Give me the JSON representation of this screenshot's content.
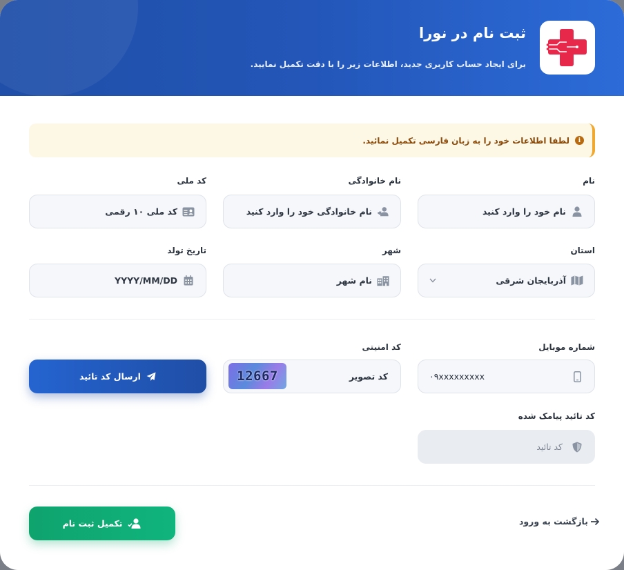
{
  "header": {
    "title": "ثبت نام در نورا",
    "subtitle": "برای ایجاد حساب کاربری جدید، اطلاعات زیر را با دقت تکمیل نمایید."
  },
  "alert": {
    "icon": "info-icon",
    "text": "لطفا اطلاعات خود را به زبان فارسی تکمیل نمائید."
  },
  "fields": {
    "first_name": {
      "label": "نام",
      "placeholder": "نام خود را وارد کنید",
      "icon": "user-icon"
    },
    "last_name": {
      "label": "نام خانوادگی",
      "placeholder": "نام خانوادگی خود را وارد کنید",
      "icon": "user-tag-icon"
    },
    "national_code": {
      "label": "کد ملی",
      "placeholder": "کد ملی ۱۰ رقمی",
      "icon": "id-card-icon"
    },
    "province": {
      "label": "استان",
      "value": "آذربایجان شرقی",
      "icon": "map-icon"
    },
    "city": {
      "label": "شهر",
      "placeholder": "نام شهر",
      "icon": "building-icon"
    },
    "birth_date": {
      "label": "تاریخ تولد",
      "placeholder": "YYYY/MM/DD",
      "icon": "calendar-icon"
    },
    "mobile": {
      "label": "شماره موبایل",
      "value": "۰۹xxxxxxxxx",
      "icon": "mobile-icon"
    },
    "security_code": {
      "label": "کد امنیتی",
      "placeholder": "کد تصویر",
      "captcha": "12667"
    },
    "sms_code": {
      "label": "کد تائید پیامک شده",
      "placeholder": "کد تائید",
      "icon": "shield-icon"
    }
  },
  "buttons": {
    "send_code": "ارسال کد تائید",
    "complete": "تکمیل ثبت نام",
    "back": "بازگشت به ورود"
  },
  "colors": {
    "header_blue": "#2356b8",
    "primary_button": "#2564d0",
    "success_button": "#10b47d",
    "alert_bg": "#fdf7e6",
    "alert_border": "#f0a830",
    "logo_red": "#e8284a"
  }
}
